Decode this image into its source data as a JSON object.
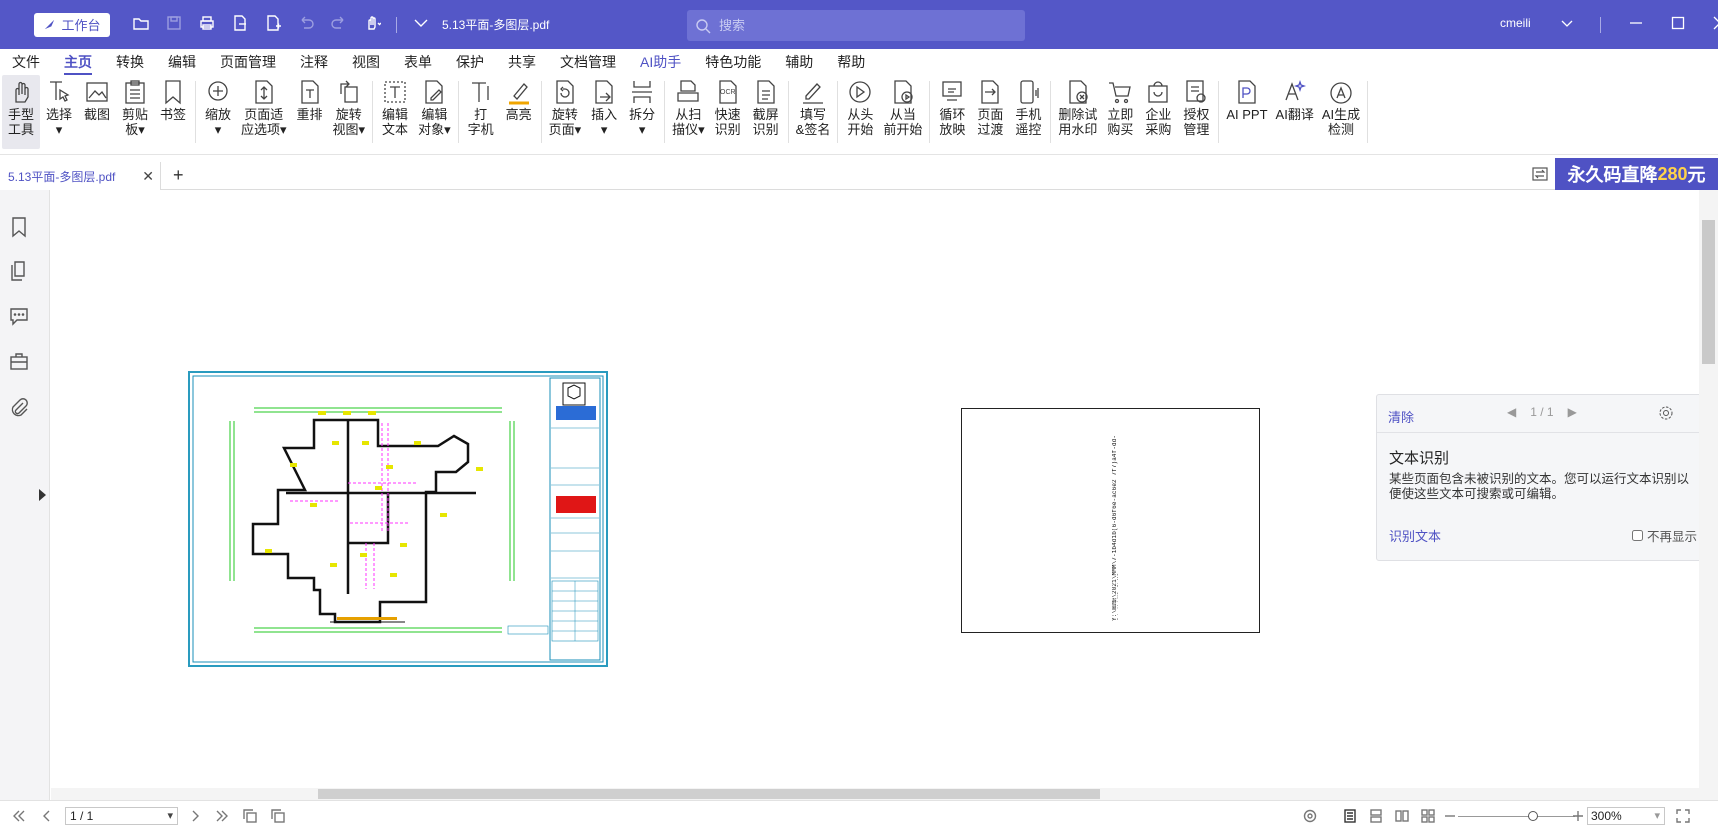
{
  "titlebar": {
    "workbench": "工作台",
    "file_name": "5.13平面-多图层.pdf",
    "search_placeholder": "搜索",
    "user": "cmeili"
  },
  "menu": [
    "文件",
    "主页",
    "转换",
    "编辑",
    "页面管理",
    "注释",
    "视图",
    "表单",
    "保护",
    "共享",
    "文档管理",
    "AI助手",
    "特色功能",
    "辅助",
    "帮助"
  ],
  "ribbon": [
    {
      "label": "手型\n工具",
      "icon": "hand-icon"
    },
    {
      "label": "选择\n▾",
      "icon": "select-cursor-icon"
    },
    {
      "label": "截图",
      "icon": "screenshot-icon"
    },
    {
      "label": "剪贴\n板▾",
      "icon": "clipboard-icon"
    },
    {
      "label": "书签",
      "icon": "bookmark-icon"
    },
    {
      "label": "缩放\n▾",
      "icon": "zoom-icon"
    },
    {
      "label": "页面适\n应选项▾",
      "icon": "fit-page-icon"
    },
    {
      "label": "重排",
      "icon": "reflow-icon"
    },
    {
      "label": "旋转\n视图▾",
      "icon": "rotate-view-icon"
    },
    {
      "label": "编辑\n文本",
      "icon": "edit-text-icon"
    },
    {
      "label": "编辑\n对象▾",
      "icon": "edit-object-icon"
    },
    {
      "label": "打\n字机",
      "icon": "typewriter-icon"
    },
    {
      "label": "高亮",
      "icon": "highlight-icon"
    },
    {
      "label": "旋转\n页面▾",
      "icon": "rotate-page-icon"
    },
    {
      "label": "插入\n▾",
      "icon": "insert-page-icon"
    },
    {
      "label": "拆分\n▾",
      "icon": "split-icon"
    },
    {
      "label": "从扫\n描仪▾",
      "icon": "scanner-icon"
    },
    {
      "label": "快速\n识别",
      "icon": "ocr-icon"
    },
    {
      "label": "截屏\n识别",
      "icon": "screen-ocr-icon"
    },
    {
      "label": "填写\n&签名",
      "icon": "sign-icon"
    },
    {
      "label": "从头\n开始",
      "icon": "play-start-icon"
    },
    {
      "label": "从当\n前开始",
      "icon": "play-current-icon"
    },
    {
      "label": "循环\n放映",
      "icon": "loop-play-icon"
    },
    {
      "label": "页面\n过渡",
      "icon": "page-transition-icon"
    },
    {
      "label": "手机\n遥控",
      "icon": "phone-remote-icon"
    },
    {
      "label": "删除试\n用水印",
      "icon": "remove-watermark-icon"
    },
    {
      "label": "立即\n购买",
      "icon": "cart-icon"
    },
    {
      "label": "企业\n采购",
      "icon": "enterprise-bag-icon"
    },
    {
      "label": "授权\n管理",
      "icon": "license-icon"
    },
    {
      "label": "AI PPT",
      "icon": "ai-ppt-icon"
    },
    {
      "label": "AI翻译",
      "icon": "ai-translate-icon"
    },
    {
      "label": "AI生成\n检测",
      "icon": "ai-detect-icon"
    }
  ],
  "tab": {
    "name": "5.13平面-多图层.pdf"
  },
  "promo": {
    "text": "永久码直降",
    "amount": "280",
    "unit": "元"
  },
  "ocr_panel": {
    "clear": "清除",
    "pager": "1 / 1",
    "title": "文本识别",
    "description": "某些页面包含未被识别的文本。您可以运行文本识别以便使这些文本可搜索或可编辑。",
    "run": "识别文本",
    "dont_show": "不再显示"
  },
  "page2_text": "Y:\\图纸\\2021\\MMM\\7-1b4d1b(6-d6f6e-ac6e2 7f7)a4f-dd-6dc1b\\MO-2\\M6.png",
  "status": {
    "page": "1 / 1",
    "zoom": "300%"
  },
  "colors": {
    "accent": "#5457c7",
    "promo_amount": "#ffd24a",
    "drawing_frame": "#2a9bbf"
  }
}
